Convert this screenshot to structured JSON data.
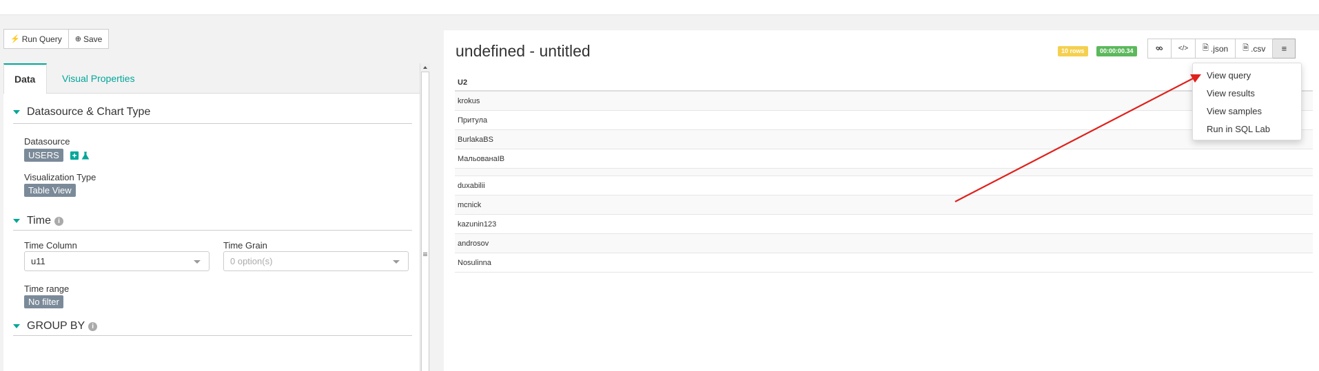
{
  "toolbar": {
    "run_query": "Run Query",
    "save": "Save"
  },
  "tabs": [
    {
      "label": "Data"
    },
    {
      "label": "Visual Properties"
    }
  ],
  "sections": {
    "datasource_chart": {
      "title": "Datasource & Chart Type",
      "datasource_label": "Datasource",
      "datasource_value": "USERS",
      "viz_label": "Visualization Type",
      "viz_value": "Table View"
    },
    "time": {
      "title": "Time",
      "time_column_label": "Time Column",
      "time_column_value": "u11",
      "time_grain_label": "Time Grain",
      "time_grain_placeholder": "0 option(s)",
      "time_range_label": "Time range",
      "time_range_value": "No filter"
    },
    "group_by": {
      "title": "GROUP BY"
    }
  },
  "chart": {
    "title": "undefined - untitled",
    "rows_badge": "10 rows",
    "time_badge": "00:00:00.34",
    "buttons": {
      "json": ".json",
      "csv": ".csv"
    },
    "table": {
      "header": "U2",
      "rows": [
        "krokus",
        "Притула",
        "BurlakaBS",
        "МальованаІВ",
        "",
        "duxabilii",
        "mcnick",
        "kazunin123",
        "androsov",
        "Nosulinna"
      ]
    }
  },
  "menu": {
    "items": [
      "View query",
      "View results",
      "View samples",
      "Run in SQL Lab"
    ]
  },
  "colors": {
    "accent": "#00a699",
    "tag": "#7b8a99",
    "rows_badge": "#f5d04f",
    "time_badge": "#5cb85c",
    "annotation_arrow": "#e0201b"
  }
}
